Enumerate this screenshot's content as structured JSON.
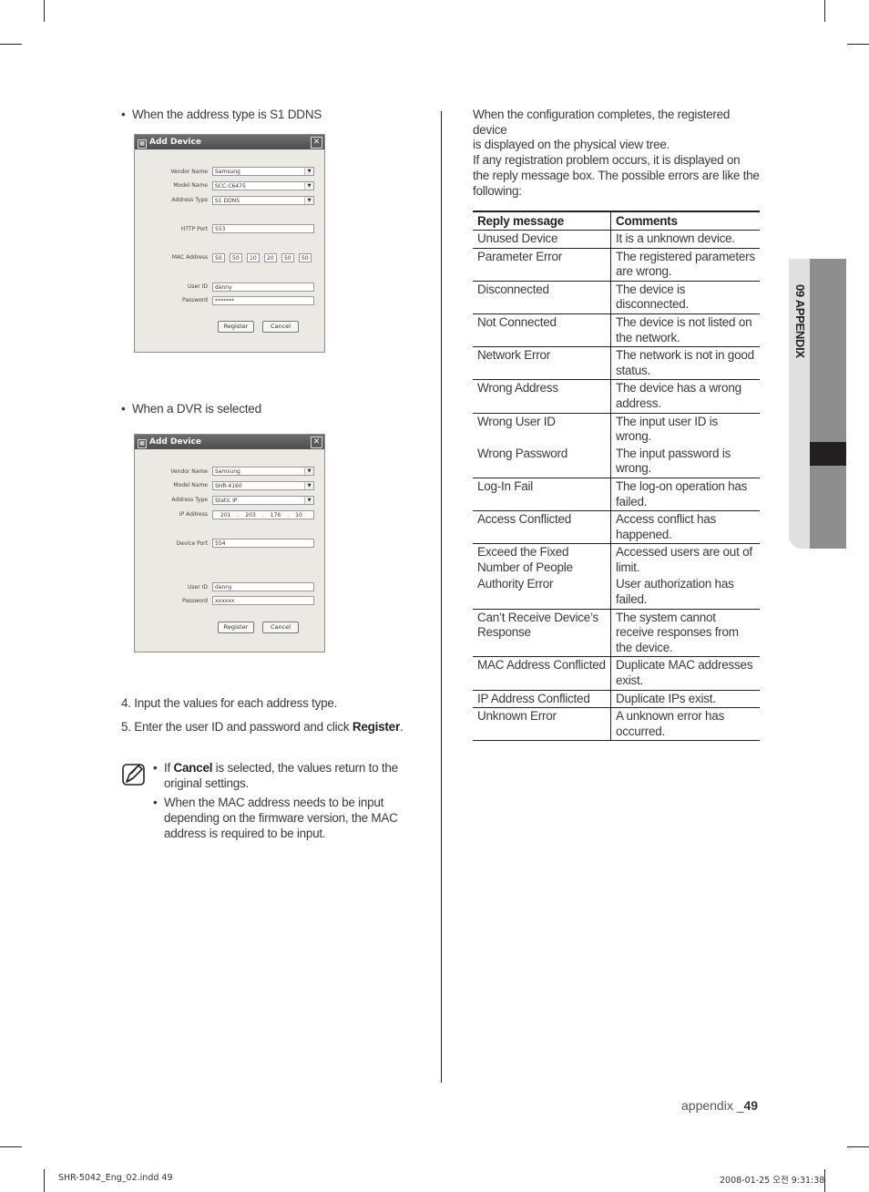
{
  "left_column": {
    "bullet_ddns": "When the address type is S1 DDNS",
    "dialog_ddns": {
      "title": "Add Device",
      "fields": {
        "vendor_name": {
          "label": "Vendor Name",
          "value": "Samsung"
        },
        "model_name": {
          "label": "Model Name",
          "value": "SCC-C6475"
        },
        "address_type": {
          "label": "Address Type",
          "value": "S1 DDNS"
        },
        "http_port": {
          "label": "HTTP Port",
          "value": "553"
        },
        "mac_address": {
          "label": "MAC Address",
          "values": [
            "50",
            "50",
            "10",
            "20",
            "50",
            "50"
          ]
        },
        "user_id": {
          "label": "User ID",
          "value": "danny"
        },
        "password": {
          "label": "Password",
          "value": "*******"
        }
      },
      "register_label": "Register",
      "cancel_label": "Cancel"
    },
    "bullet_dvr": "When a DVR is selected",
    "dialog_dvr": {
      "title": "Add Device",
      "fields": {
        "vendor_name": {
          "label": "Vendor Name",
          "value": "Samsung"
        },
        "model_name": {
          "label": "Model Name",
          "value": "SHR-4160"
        },
        "address_type": {
          "label": "Address Type",
          "value": "Static IP"
        },
        "ip_address": {
          "label": "IP Address",
          "values": [
            "201",
            "203",
            "176",
            "10"
          ]
        },
        "device_port": {
          "label": "Device Port",
          "value": "554"
        },
        "user_id": {
          "label": "User ID",
          "value": "danny"
        },
        "password": {
          "label": "Password",
          "value": "xxxxxx"
        }
      },
      "register_label": "Register",
      "cancel_label": "Cancel"
    },
    "steps": [
      {
        "number": "4.",
        "text": "Input the values for each address type."
      },
      {
        "number": "5.",
        "text_before": "Enter the user ID and password and click ",
        "bold": "Register",
        "text_after": "."
      }
    ],
    "note": {
      "icon": "note-pencil-icon",
      "items": [
        {
          "prefix": "If ",
          "bold": "Cancel",
          "text": " is selected, the values return to the original settings."
        },
        {
          "text": "When the MAC address needs to be input depending on the firmware version, the MAC address is required to be input."
        }
      ]
    }
  },
  "right_column": {
    "intro_lines": [
      "When the configuration completes, the registered device",
      "is displayed on the physical view tree.",
      "If any registration problem occurs, it is displayed on",
      "the reply message box. The possible errors are like the",
      "following:"
    ],
    "table": {
      "headers": [
        "Reply message",
        "Comments"
      ],
      "rows": [
        [
          "Unused Device",
          "It is a unknown device."
        ],
        [
          "Parameter Error",
          "The registered parameters are wrong."
        ],
        [
          "Disconnected",
          "The device is disconnected."
        ],
        [
          "Not Connected",
          "The device is not listed on the network."
        ],
        [
          "Network Error",
          "The network is not in good status."
        ],
        [
          "Wrong Address",
          "The device has a wrong address."
        ],
        [
          "Wrong User ID",
          "The input user ID is wrong."
        ],
        [
          "Wrong Password",
          "The input password is wrong."
        ],
        [
          "Log-In Fail",
          "The log-on operation has failed."
        ],
        [
          "Access Conflicted",
          "Access conflict has happened."
        ],
        [
          "Exceed the Fixed Number of People",
          "Accessed users are out of limit."
        ],
        [
          "Authority Error",
          "User authorization has failed."
        ],
        [
          "Can’t Receive Device’s Response",
          "The system cannot receive responses from the device."
        ],
        [
          "MAC Address Conflicted",
          "Duplicate MAC addresses exist."
        ],
        [
          "IP Address Conflicted",
          "Duplicate IPs exist."
        ],
        [
          "Unknown Error",
          "A unknown error has occurred."
        ]
      ]
    }
  },
  "side_tab": {
    "label": "09 APPENDIX"
  },
  "footer": {
    "section": "appendix _",
    "page_number": "49",
    "slug_left": "SHR-5042_Eng_02.indd   49",
    "slug_right": "2008-01-25   오전 9:31:38"
  }
}
